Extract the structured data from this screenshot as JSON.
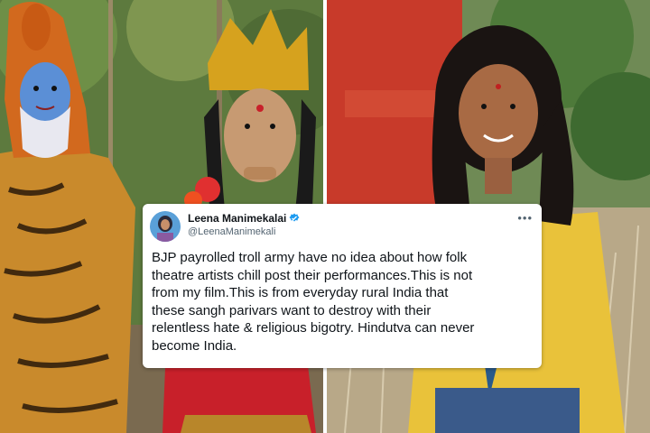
{
  "tweet": {
    "display_name": "Leena Manimekalai",
    "handle": "@LeenaManimekali",
    "text": "BJP payrolled troll army have no idea about how folk\ntheatre artists chill post their performances.This is not\nfrom my film.This is from everyday rural India that\nthese sangh parivars want to destroy with their\nrelentless hate & religious bigotry. Hindutva can never\nbecome India.",
    "verified_icon": "verified-badge-icon",
    "more_icon": "more-options-icon"
  },
  "colors": {
    "verified": "#1d9bf0",
    "text": "#0f1419",
    "handle": "#536471",
    "card_bg": "#ffffff"
  }
}
